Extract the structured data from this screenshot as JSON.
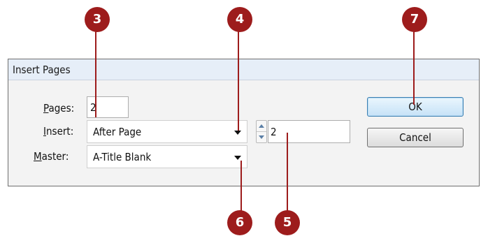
{
  "dialog": {
    "title": "Insert Pages",
    "pages": {
      "label_accel": "P",
      "label_rest": "ages:",
      "value": "2"
    },
    "insert": {
      "label_accel": "I",
      "label_rest": "nsert:",
      "value": "After Page",
      "page_number": "2"
    },
    "master": {
      "label_accel": "M",
      "label_rest": "aster:",
      "value": "A-Title Blank"
    },
    "buttons": {
      "ok": "OK",
      "cancel": "Cancel"
    }
  },
  "callouts": [
    "3",
    "4",
    "7",
    "6",
    "5"
  ],
  "colors": {
    "callout": "#9d1c1c",
    "ok_border": "#3c7fb1"
  }
}
